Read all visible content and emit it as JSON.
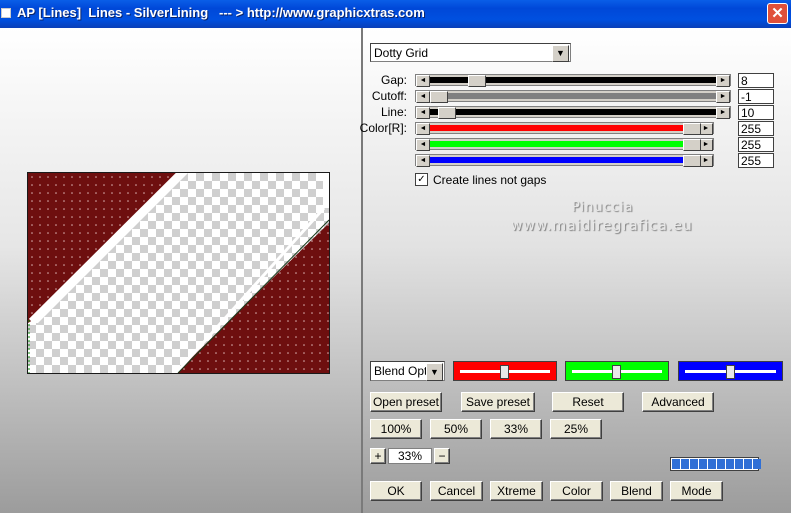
{
  "window": {
    "title": "AP [Lines]  Lines - SilverLining   --- > http://www.graphicxtras.com",
    "close_glyph": "✕"
  },
  "preview": {
    "colors": {
      "dark_red": "#6e0f0f",
      "dots": "#d9b0b0",
      "transparency_checker": "#cfcfcf"
    }
  },
  "preset_dropdown": {
    "value": "Dotty Grid",
    "arrow": "▼"
  },
  "sliders": [
    {
      "label": "Gap:",
      "value": "8",
      "fill_color": "#000000",
      "level": 0.14
    },
    {
      "label": "Cutoff:",
      "value": "-1",
      "fill_color": "#808080",
      "level": 0.0
    },
    {
      "label": "Line:",
      "value": "10",
      "fill_color": "#000000",
      "level": 0.03
    },
    {
      "label": "Color[R]:",
      "value": "255",
      "fill_color": "#ff0000",
      "level": 1.0
    },
    {
      "label": "",
      "value": "255",
      "fill_color": "#00ff00",
      "level": 1.0
    },
    {
      "label": "",
      "value": "255",
      "fill_color": "#0000ff",
      "level": 1.0
    }
  ],
  "arrows": {
    "left": "◄",
    "right": "►"
  },
  "checkbox": {
    "label": "Create lines not gaps",
    "checked": true,
    "mark": "✓"
  },
  "watermark": {
    "line1": "Pinuccia",
    "line2": "www.maidiregrafica.eu"
  },
  "blend_dropdown": {
    "value": "Blend Optic",
    "arrow": "▼"
  },
  "color_pickers": [
    {
      "name": "red",
      "color": "#ff0000",
      "level": 0.5
    },
    {
      "name": "green",
      "color": "#00ff00",
      "level": 0.5
    },
    {
      "name": "blue",
      "color": "#0000ff",
      "level": 0.5
    }
  ],
  "buttons": {
    "open_preset": "Open preset",
    "save_preset": "Save preset",
    "reset": "Reset",
    "advanced": "Advanced",
    "zoom_100": "100%",
    "zoom_50": "50%",
    "zoom_33": "33%",
    "zoom_25": "25%",
    "ok": "OK",
    "cancel": "Cancel",
    "xtreme": "Xtreme",
    "color": "Color",
    "blend": "Blend",
    "mode": "Mode"
  },
  "zoom": {
    "plus": "+",
    "value": "33%",
    "minus": "−"
  },
  "progress": {
    "cells": 10,
    "filled": 10,
    "color": "#2f6fd6"
  }
}
